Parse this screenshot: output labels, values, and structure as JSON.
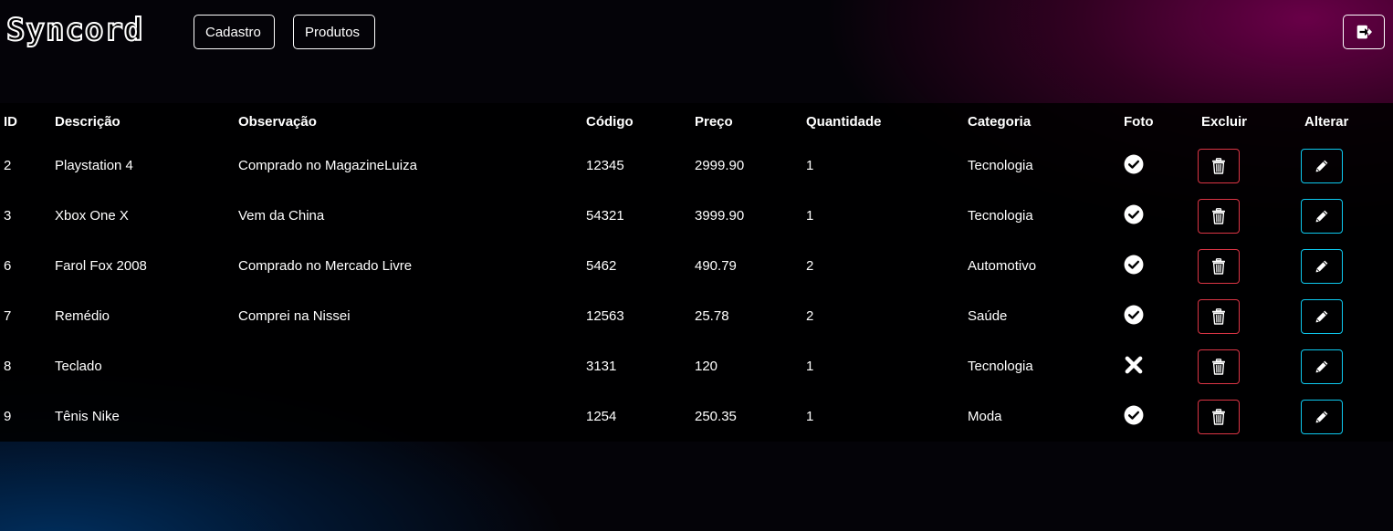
{
  "app": {
    "logo_text": "Syncord"
  },
  "nav": {
    "cadastro_label": "Cadastro",
    "produtos_label": "Produtos",
    "logout_icon": "logout-icon"
  },
  "table": {
    "headers": {
      "id": "ID",
      "descricao": "Descrição",
      "observacao": "Observação",
      "codigo": "Código",
      "preco": "Preço",
      "quantidade": "Quantidade",
      "categoria": "Categoria",
      "foto": "Foto",
      "excluir": "Excluir",
      "alterar": "Alterar"
    },
    "rows": [
      {
        "id": "2",
        "descricao": "Playstation 4",
        "observacao": "Comprado no MagazineLuiza",
        "codigo": "12345",
        "preco": "2999.90",
        "quantidade": "1",
        "categoria": "Tecnologia",
        "foto": true
      },
      {
        "id": "3",
        "descricao": "Xbox One X",
        "observacao": "Vem da China",
        "codigo": "54321",
        "preco": "3999.90",
        "quantidade": "1",
        "categoria": "Tecnologia",
        "foto": true
      },
      {
        "id": "6",
        "descricao": "Farol Fox 2008",
        "observacao": "Comprado no Mercado Livre",
        "codigo": "5462",
        "preco": "490.79",
        "quantidade": "2",
        "categoria": "Automotivo",
        "foto": true
      },
      {
        "id": "7",
        "descricao": "Remédio",
        "observacao": "Comprei na Nissei",
        "codigo": "12563",
        "preco": "25.78",
        "quantidade": "2",
        "categoria": "Saúde",
        "foto": true
      },
      {
        "id": "8",
        "descricao": "Teclado",
        "observacao": "",
        "codigo": "3131",
        "preco": "120",
        "quantidade": "1",
        "categoria": "Tecnologia",
        "foto": false
      },
      {
        "id": "9",
        "descricao": "Tênis Nike",
        "observacao": "",
        "codigo": "1254",
        "preco": "250.35",
        "quantidade": "1",
        "categoria": "Moda",
        "foto": true
      }
    ]
  },
  "colors": {
    "delete_border": "#dc3545",
    "edit_border": "#0dcaf0",
    "background_magenta": "#6e004b",
    "background_blue": "#003264"
  },
  "icons": {
    "foto_present": "check-circle-icon",
    "foto_missing": "x-icon",
    "delete": "trash-icon",
    "edit": "pencil-icon"
  }
}
